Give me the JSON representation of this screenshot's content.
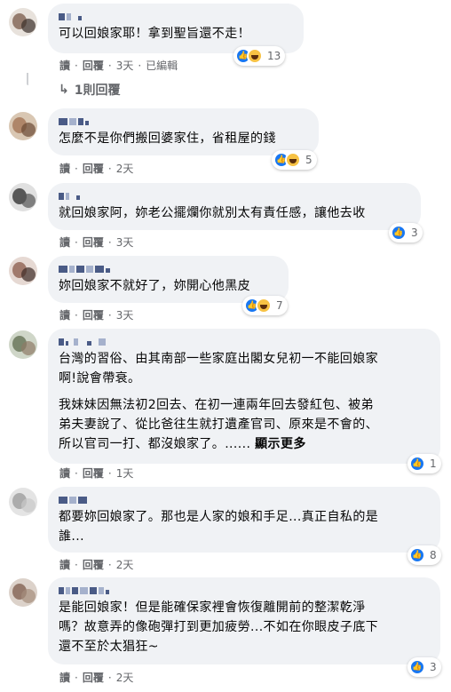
{
  "ui": {
    "actions": {
      "read": "讀",
      "reply": "回覆",
      "edited": "已編輯",
      "separator": "·"
    },
    "replies_link": "1則回覆",
    "see_more": "顯示更多"
  },
  "comments": [
    {
      "text": "可以回娘家耶！拿到聖旨還不走！",
      "reaction_count": "13",
      "time": "3天",
      "edited": true
    },
    {
      "text": "怎麼不是你們搬回婆家住，省租屋的錢",
      "reaction_count": "5",
      "time": "2天"
    },
    {
      "text": "就回娘家阿，妳老公擺爛你就別太有責任感，讓他去收",
      "reaction_count": "3",
      "time": "3天"
    },
    {
      "text": "妳回娘家不就好了，妳開心他黑皮",
      "reaction_count": "7",
      "time": "3天"
    },
    {
      "text": "台灣的習俗、由其南部一些家庭出閣女兒初一不能回娘家\n啊!說會帶衰。",
      "text2": "我妹妹因無法初2回去、在初一連兩年回去發紅包、被弟\n弟夫妻說了、從比爸往生就打遺產官司、原來是不會的、\n所以官司一打、都沒娘家了。...... ",
      "reaction_count": "1",
      "time": "1天"
    },
    {
      "text": "都要妳回娘家了。那也是人家的娘和手足...真正自私的是\n誰...",
      "reaction_count": "8",
      "time": "2天"
    },
    {
      "text": "是能回娘家！但是能確保家裡會恢復離開前的整潔乾淨\n嗎？故意弄的像砲彈打到更加疲勞...不如在你眼皮子底下\n還不至於太猖狂~",
      "reaction_count": "3",
      "time": "2天"
    }
  ],
  "colors": {
    "bubble": "#f0f2f5",
    "meta": "#65676b",
    "like": "#1877f2",
    "haha": "#f7c244"
  }
}
